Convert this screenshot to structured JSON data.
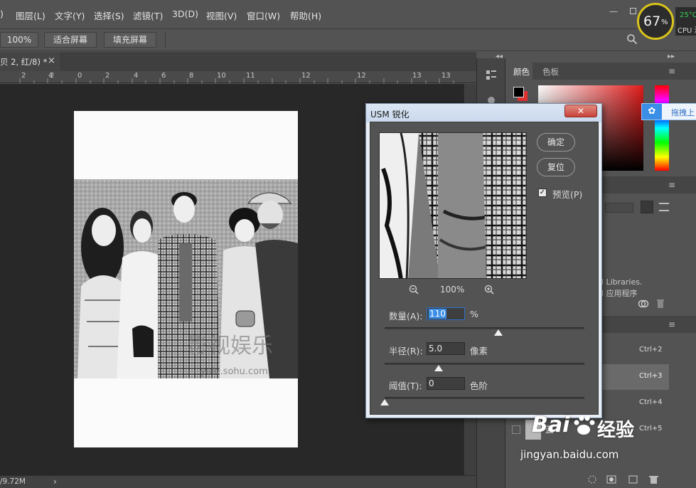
{
  "menu": {
    "items": [
      "图层(L)",
      "文字(Y)",
      "选择(S)",
      "滤镜(T)",
      "3D(D)",
      "视图(V)",
      "窗口(W)",
      "帮助(H)"
    ],
    "partial_first": ")"
  },
  "options_bar": {
    "zoom_value": "100%",
    "fit_screen": "适合屏幕",
    "fill_screen": "填充屏幕"
  },
  "document_tab": {
    "title": "贝 2, 红/8) *",
    "close": "×"
  },
  "ruler": {
    "labels": [
      "2",
      "4",
      "2",
      "0",
      "2",
      "4",
      "6",
      "8",
      "10",
      "11",
      "12",
      "13"
    ]
  },
  "status": {
    "doc_size": "/9.72M",
    "arrow": "›"
  },
  "photo": {
    "watermark_cn": "影视娱乐",
    "watermark_url": "yule.sohu.com"
  },
  "panels": {
    "color_tab": "颜色",
    "swatches_tab": "色板",
    "libraries_line1": "ud Libraries.",
    "libraries_line2": "ud 应用程序",
    "channel_shortcuts": [
      "Ctrl+2",
      "Ctrl+3",
      "Ctrl+4",
      "Ctrl+5"
    ],
    "channel_blue_label": "蓝"
  },
  "usm_dialog": {
    "title": "USM 锐化",
    "ok_label": "确定",
    "reset_label": "复位",
    "preview_label": "预览(P)",
    "preview_checked": true,
    "zoom_value": "100%",
    "amount_label": "数量(A):",
    "amount_value": "110",
    "amount_unit": "%",
    "amount_slider_fraction": 0.57,
    "radius_label": "半径(R):",
    "radius_value": "5.0",
    "radius_unit": "像素",
    "radius_slider_fraction": 0.27,
    "threshold_label": "阈值(T):",
    "threshold_value": "0",
    "threshold_unit": "色阶",
    "threshold_slider_fraction": 0.0
  },
  "overlays": {
    "cpu_percent": "67",
    "cpu_percent_sign": "%",
    "temp": "25°C",
    "cpu_text": "CPU 温",
    "drag_hint": "拖拽上",
    "baidu_text": "Bai",
    "baidu_text2": "经验",
    "baidu_url": "jingyan.baidu.com"
  },
  "colors": {
    "ps_dark": "#535353",
    "canvas_bg": "#282828",
    "dialog_frame": "#e8edf4",
    "close_red": "#c9443a",
    "highlight_blue": "#3a8ee6",
    "cpu_ring": "#d9c41b"
  }
}
